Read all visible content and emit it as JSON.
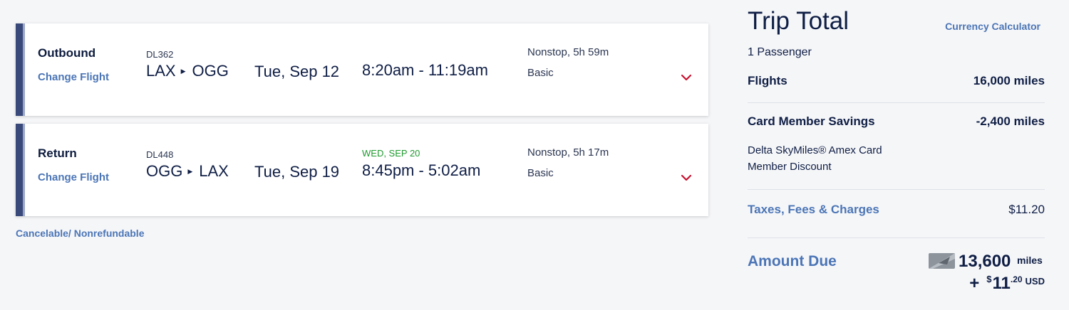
{
  "flights": [
    {
      "label": "Outbound",
      "change_label": "Change Flight",
      "flight_number": "DL362",
      "origin": "LAX",
      "destination": "OGG",
      "date": "Tue, Sep 12",
      "arrival_date_note": "",
      "times": "8:20am - 11:19am",
      "stops_duration": "Nonstop, 5h 59m",
      "fare_class": "Basic",
      "expand_icon": "chevron-down-icon"
    },
    {
      "label": "Return",
      "change_label": "Change Flight",
      "flight_number": "DL448",
      "origin": "OGG",
      "destination": "LAX",
      "date": "Tue, Sep 19",
      "arrival_date_note": "WED, SEP 20",
      "times": "8:45pm - 5:02am",
      "stops_duration": "Nonstop, 5h 17m",
      "fare_class": "Basic",
      "expand_icon": "chevron-down-icon"
    }
  ],
  "policy_note": "Cancelable/ Nonrefundable",
  "trip_total": {
    "title": "Trip Total",
    "currency_link": "Currency Calculator",
    "passengers": "1 Passenger",
    "flights_label": "Flights",
    "flights_value": "16,000 miles",
    "savings_label": "Card Member Savings",
    "savings_value": "-2,400 miles",
    "savings_desc_line1": "Delta SkyMiles® Amex Card",
    "savings_desc_line2": "Member Discount",
    "taxes_label": "Taxes, Fees & Charges",
    "taxes_value": "$11.20",
    "amount_due_label": "Amount Due",
    "amount_due_miles": "13,600",
    "amount_due_miles_unit": "miles",
    "amount_due_plus": "+",
    "amount_due_currency_symbol": "$",
    "amount_due_whole": "11",
    "amount_due_cents": ".20",
    "amount_due_currency": "USD",
    "miles_icon": "skymiles-card-icon"
  },
  "colors": {
    "navy": "#0f1e45",
    "link_blue": "#4b75b6",
    "accent_bar": "#39497a",
    "arrival_green": "#1f9a2f",
    "chevron_red": "#c8102e"
  }
}
